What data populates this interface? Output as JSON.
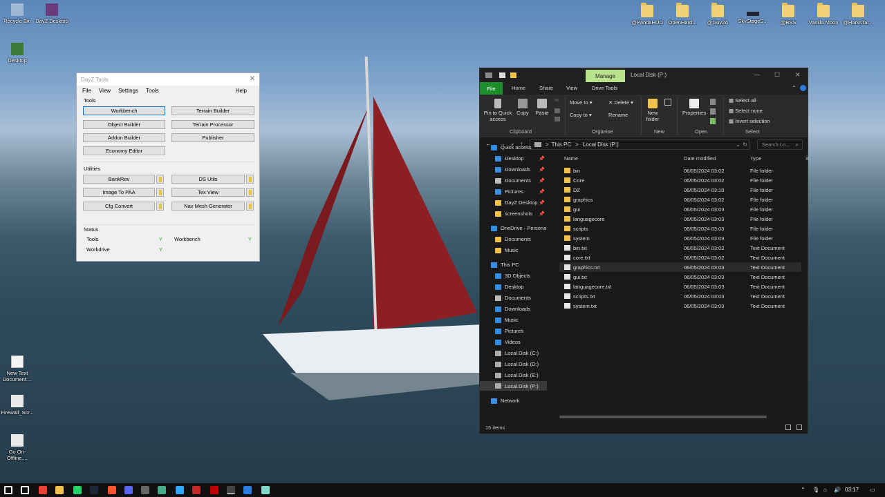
{
  "desktop": {
    "left_icons": [
      {
        "label": "Recycle Bin"
      },
      {
        "label": "DayZ Desktop"
      },
      {
        "label": "Desktop"
      },
      {
        "label": "New Text Document...."
      },
      {
        "label": "Firewall_Scr..."
      },
      {
        "label": "Go On-Offline...."
      }
    ],
    "top_right_icons": [
      {
        "label": "@PandaHUD"
      },
      {
        "label": "OpenHard..."
      },
      {
        "label": "@Guy2A"
      },
      {
        "label": "SkyStageS..."
      },
      {
        "label": "@BSS"
      },
      {
        "label": "Vanilla Moon"
      },
      {
        "label": "@HarksTar..."
      }
    ]
  },
  "dayz_tools": {
    "title": "DayZ Tools",
    "close": "✕",
    "menu": [
      "File",
      "View",
      "Settings",
      "Tools"
    ],
    "help": "Help",
    "tools_label": "Tools",
    "tools_left": [
      "Workbench",
      "Object Builder",
      "Addon Builder",
      "Economy Editor"
    ],
    "tools_right": [
      "Terrain Builder",
      "Terrain Processor",
      "Publisher"
    ],
    "utilities_label": "Utilities",
    "utilities_left": [
      "BankRev",
      "Image To PAA",
      "Cfg Convert"
    ],
    "utilities_right": [
      "DS Utils",
      "Tex View",
      "Nav Mesh Generator"
    ],
    "status_label": "Status",
    "status": [
      {
        "name": "Tools",
        "value": "Y"
      },
      {
        "name": "Workdrive",
        "value": "Y"
      },
      {
        "name": "Workbench",
        "value": "Y"
      }
    ]
  },
  "explorer": {
    "manage_tab": "Manage",
    "title": "Local Disk (P:)",
    "tabs": [
      "File",
      "Home",
      "Share",
      "View",
      "Drive Tools"
    ],
    "ribbon": {
      "pin": "Pin to Quick access",
      "copy": "Copy",
      "paste": "Paste",
      "clipboard": "Clipboard",
      "move_to": "Move to",
      "copy_to": "Copy to",
      "delete": "Delete",
      "rename": "Rename",
      "organise": "Organise",
      "new_folder": "New folder",
      "new": "New",
      "properties": "Properties",
      "open": "Open",
      "select_all": "Select all",
      "select_none": "Select none",
      "invert_selection": "Invert selection",
      "select": "Select"
    },
    "address": {
      "this_pc": "This PC",
      "sep": ">",
      "current": "Local Disk (P:)"
    },
    "search_placeholder": "Search Lo...",
    "nav": [
      {
        "label": "Quick access",
        "kind": "star",
        "pin": ""
      },
      {
        "label": "Desktop",
        "kind": "blue",
        "pin": "📌"
      },
      {
        "label": "Downloads",
        "kind": "blue",
        "pin": "📌"
      },
      {
        "label": "Documents",
        "kind": "grey",
        "pin": "📌"
      },
      {
        "label": "Pictures",
        "kind": "blue",
        "pin": "📌"
      },
      {
        "label": "DayZ Desktop",
        "kind": "yellow",
        "pin": "📌"
      },
      {
        "label": "screenshots",
        "kind": "yellow",
        "pin": "📌"
      },
      {
        "label": "OneDrive - Persona",
        "kind": "cloud",
        "pin": ""
      },
      {
        "label": "Documents",
        "kind": "yellow",
        "pin": ""
      },
      {
        "label": "Music",
        "kind": "yellow",
        "pin": ""
      },
      {
        "label": "This PC",
        "kind": "pc",
        "pin": ""
      },
      {
        "label": "3D Objects",
        "kind": "blue",
        "pin": ""
      },
      {
        "label": "Desktop",
        "kind": "blue",
        "pin": ""
      },
      {
        "label": "Documents",
        "kind": "grey",
        "pin": ""
      },
      {
        "label": "Downloads",
        "kind": "blue",
        "pin": ""
      },
      {
        "label": "Music",
        "kind": "blue",
        "pin": ""
      },
      {
        "label": "Pictures",
        "kind": "blue",
        "pin": ""
      },
      {
        "label": "Videos",
        "kind": "blue",
        "pin": ""
      },
      {
        "label": "Local Disk (C:)",
        "kind": "drive",
        "pin": ""
      },
      {
        "label": "Local Disk (D:)",
        "kind": "drive",
        "pin": ""
      },
      {
        "label": "Local Disk (E:)",
        "kind": "drive",
        "pin": ""
      },
      {
        "label": "Local Disk (P:)",
        "kind": "drive",
        "pin": ""
      },
      {
        "label": "Network",
        "kind": "net",
        "pin": ""
      }
    ],
    "columns": [
      "Name",
      "Date modified",
      "Type",
      "S"
    ],
    "files": [
      {
        "name": "bin",
        "date": "06/05/2024 03:02",
        "type": "File folder",
        "folder": true
      },
      {
        "name": "Core",
        "date": "06/05/2024 03:02",
        "type": "File folder",
        "folder": true
      },
      {
        "name": "DZ",
        "date": "06/05/2024 03:10",
        "type": "File folder",
        "folder": true
      },
      {
        "name": "graphics",
        "date": "06/05/2024 03:02",
        "type": "File folder",
        "folder": true
      },
      {
        "name": "gui",
        "date": "06/05/2024 03:03",
        "type": "File folder",
        "folder": true
      },
      {
        "name": "languagecore",
        "date": "06/05/2024 03:03",
        "type": "File folder",
        "folder": true
      },
      {
        "name": "scripts",
        "date": "06/05/2024 03:03",
        "type": "File folder",
        "folder": true
      },
      {
        "name": "system",
        "date": "06/05/2024 03:03",
        "type": "File folder",
        "folder": true
      },
      {
        "name": "bin.txt",
        "date": "06/05/2024 03:02",
        "type": "Text Document",
        "folder": false
      },
      {
        "name": "core.txt",
        "date": "06/05/2024 03:02",
        "type": "Text Document",
        "folder": false
      },
      {
        "name": "graphics.txt",
        "date": "06/05/2024 03:03",
        "type": "Text Document",
        "folder": false
      },
      {
        "name": "gui.txt",
        "date": "06/05/2024 03:03",
        "type": "Text Document",
        "folder": false
      },
      {
        "name": "languagecore.txt",
        "date": "06/05/2024 03:03",
        "type": "Text Document",
        "folder": false
      },
      {
        "name": "scripts.txt",
        "date": "06/05/2024 03:03",
        "type": "Text Document",
        "folder": false
      },
      {
        "name": "system.txt",
        "date": "06/05/2024 03:03",
        "type": "Text Document",
        "folder": false
      }
    ],
    "status": "15 items"
  },
  "taskbar": {
    "clock": "03:17",
    "icons": [
      "start-icon",
      "search-icon",
      "chrome-icon",
      "explorer-icon",
      "whatsapp-icon",
      "steam-icon",
      "brave-icon",
      "discord-icon",
      "dayz-icon",
      "dayz-tools-icon",
      "photoshop-icon",
      "app-red-icon",
      "filezilla-icon",
      "obs-icon",
      "terminal-icon",
      "notepad-icon"
    ]
  },
  "colors": {
    "explorer_accent": "#1d8e2c",
    "manage_tab": "#b9e28d",
    "folder": "#f0c24c",
    "status_ok": "#1aa41a"
  }
}
